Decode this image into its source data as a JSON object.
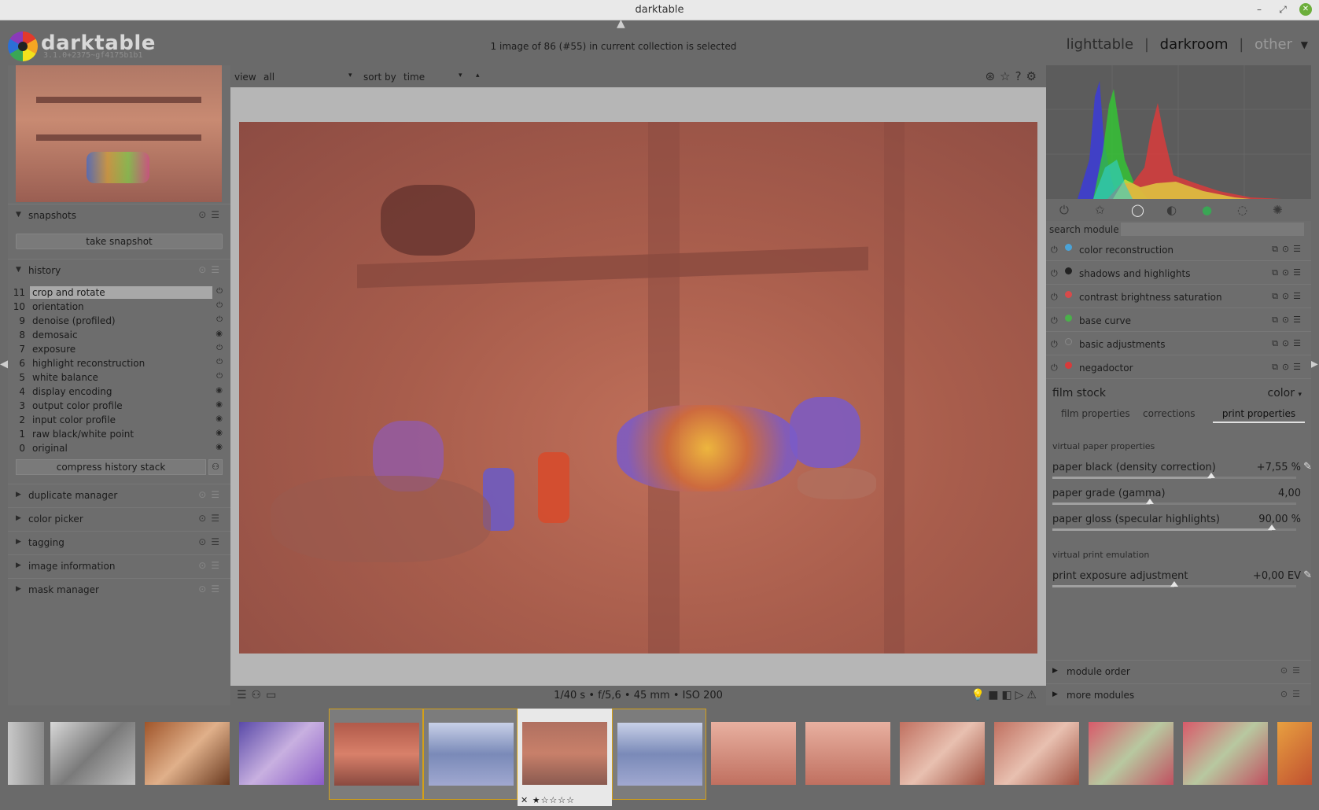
{
  "window": {
    "title": "darktable"
  },
  "header": {
    "app_name": "darktable",
    "version": "3.1.0+2375~gf4175b1b1",
    "collection_status": "1 image of 86 (#55) in current collection is selected",
    "views": [
      "lighttable",
      "darkroom",
      "other"
    ],
    "view_separator": "|",
    "active_view": "darkroom"
  },
  "left": {
    "snapshots": {
      "label": "snapshots",
      "take_label": "take snapshot"
    },
    "history": {
      "label": "history",
      "items": [
        {
          "num": "11",
          "name": "crop and rotate",
          "selected": true
        },
        {
          "num": "10",
          "name": "orientation"
        },
        {
          "num": "9",
          "name": "denoise (profiled)"
        },
        {
          "num": "8",
          "name": "demosaic"
        },
        {
          "num": "7",
          "name": "exposure"
        },
        {
          "num": "6",
          "name": "highlight reconstruction"
        },
        {
          "num": "5",
          "name": "white balance"
        },
        {
          "num": "4",
          "name": "display encoding"
        },
        {
          "num": "3",
          "name": "output color profile"
        },
        {
          "num": "2",
          "name": "input color profile"
        },
        {
          "num": "1",
          "name": "raw black/white point"
        },
        {
          "num": "0",
          "name": "original"
        }
      ],
      "compress_label": "compress history stack"
    },
    "sections": [
      "duplicate manager",
      "color picker",
      "tagging",
      "image information",
      "mask manager"
    ]
  },
  "center": {
    "view_label": "view",
    "view_value": "all",
    "sort_label": "sort by",
    "sort_value": "time",
    "exif": "1/40 s • f/5,6 • 45 mm • ISO 200"
  },
  "right": {
    "search_label": "search module",
    "modules": [
      {
        "name": "color reconstruction",
        "color": "#4aa3d8"
      },
      {
        "name": "shadows and highlights",
        "color": "#222222"
      },
      {
        "name": "contrast brightness saturation",
        "color": "#d84a4a"
      },
      {
        "name": "base curve",
        "color": "#4ab04a"
      },
      {
        "name": "basic adjustments",
        "color": "#7a7a7a"
      },
      {
        "name": "negadoctor",
        "color": "#d83a3a"
      }
    ],
    "film_stock": {
      "label": "film stock",
      "value": "color"
    },
    "tabs": [
      "film properties",
      "corrections",
      "print properties"
    ],
    "active_tab": "print properties",
    "virtual_paper": {
      "title": "virtual paper properties",
      "sliders": [
        {
          "label": "paper black (density correction)",
          "value": "+7,55 %",
          "level": 0.65
        },
        {
          "label": "paper grade (gamma)",
          "value": "4,00",
          "level": 0.4
        },
        {
          "label": "paper gloss (specular highlights)",
          "value": "90,00 %",
          "level": 0.9
        }
      ]
    },
    "virtual_print": {
      "title": "virtual print emulation",
      "sliders": [
        {
          "label": "print exposure adjustment",
          "value": "+0,00 EV",
          "level": 0.5
        }
      ]
    },
    "bottom_sections": [
      "module order",
      "more modules"
    ]
  }
}
